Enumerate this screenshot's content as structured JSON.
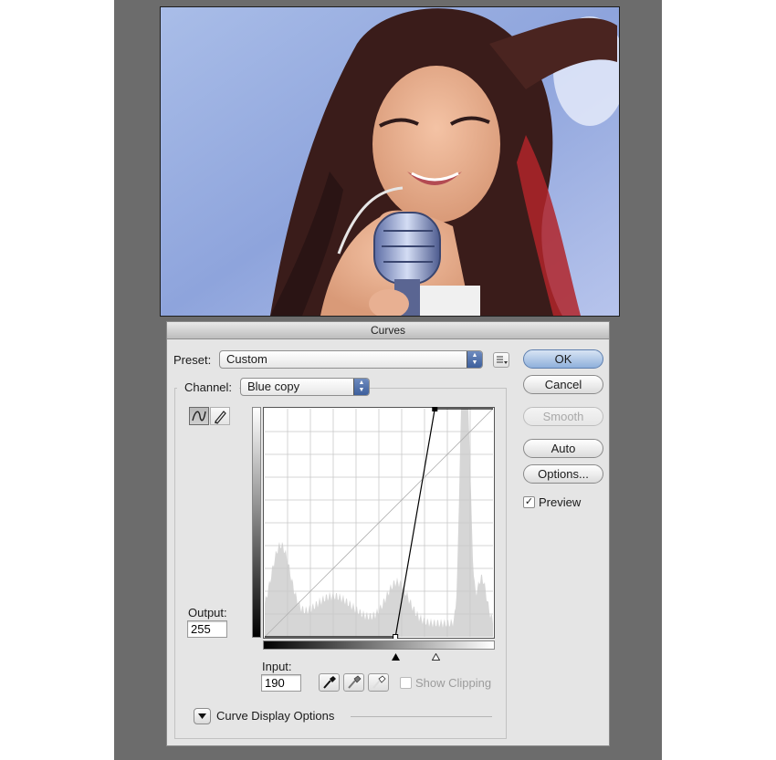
{
  "dialog": {
    "title": "Curves",
    "preset_label": "Preset:",
    "preset_value": "Custom",
    "channel_label": "Channel:",
    "channel_value": "Blue copy",
    "output_label": "Output:",
    "output_value": "255",
    "input_label": "Input:",
    "input_value": "190",
    "show_clipping_label": "Show Clipping",
    "show_clipping_checked": false,
    "curve_display_options_label": "Curve Display Options",
    "buttons": {
      "ok": "OK",
      "cancel": "Cancel",
      "smooth": "Smooth",
      "auto": "Auto",
      "options": "Options..."
    },
    "preview_label": "Preview",
    "preview_checked": true
  },
  "icons": {
    "preset_menu": "preset-options-icon",
    "curve_tool": "curve-point-icon",
    "pencil_tool": "pencil-icon",
    "black_eyedropper": "black-eyedropper-icon",
    "gray_eyedropper": "gray-eyedropper-icon",
    "white_eyedropper": "white-eyedropper-icon",
    "disclosure": "disclosure-triangle-icon"
  },
  "colors": {
    "workspace": "#6c6c6c",
    "dialog_bg": "#e5e5e5",
    "ok_accent": "#8fb0db",
    "histogram": "#d6d6d6"
  },
  "curve": {
    "channel_range": [
      0,
      255
    ],
    "grid_divisions": 10,
    "points": [
      {
        "input": 146,
        "output": 0
      },
      {
        "input": 190,
        "output": 255
      }
    ]
  }
}
